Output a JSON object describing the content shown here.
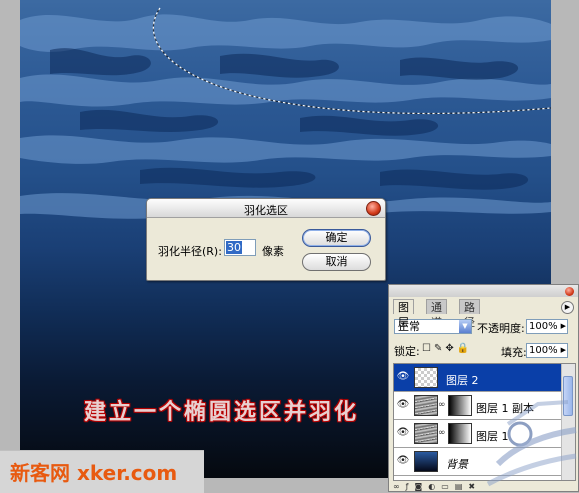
{
  "canvas": {
    "caption": "建立一个椭圆选区并羽化"
  },
  "watermark": {
    "text": "新客网 xker.com"
  },
  "feather_dialog": {
    "title": "羽化选区",
    "radius_label": "羽化半径(R):",
    "radius_value": "30",
    "unit": "像素",
    "ok_label": "确定",
    "cancel_label": "取消"
  },
  "layers_panel": {
    "tabs": [
      "图层",
      "通道",
      "路径"
    ],
    "active_tab": "图层",
    "blend_mode": "正常",
    "opacity_label": "不透明度:",
    "opacity_value": "100%",
    "lock_label": "锁定:",
    "fill_label": "填充:",
    "fill_value": "100%",
    "layers": [
      {
        "name": "图层 2",
        "selected": true
      },
      {
        "name": "图层 1 副本",
        "selected": false
      },
      {
        "name": "图层 1",
        "selected": false
      },
      {
        "name": "背景",
        "selected": false
      }
    ]
  },
  "colors": {
    "selection_highlight": "#0a3fa8",
    "caption_red": "#c00000",
    "watermark_orange": "#e85a10"
  }
}
